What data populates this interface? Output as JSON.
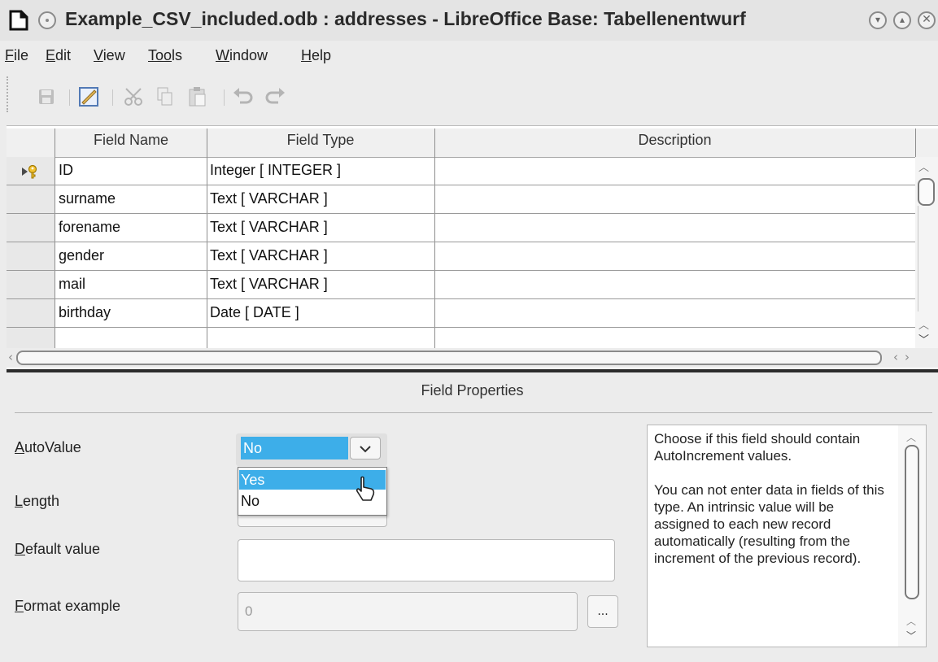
{
  "window": {
    "title": "Example_CSV_included.odb : addresses - LibreOffice Base: Tabellenentwurf",
    "controls": [
      "minimize-icon",
      "maximize-icon",
      "close-icon"
    ]
  },
  "menu": [
    {
      "label": "File",
      "u": "F",
      "rest": "ile"
    },
    {
      "label": "Edit",
      "u": "E",
      "rest": "dit"
    },
    {
      "label": "View",
      "u": "V",
      "rest": "iew"
    },
    {
      "label": "Tools",
      "u": "Too",
      "rest": "ls"
    },
    {
      "label": "Window",
      "u": "W",
      "rest": "indow"
    },
    {
      "label": "Help",
      "u": "H",
      "rest": "elp"
    }
  ],
  "toolbar": [
    "save-icon",
    "edit-mode-icon",
    "cut-icon",
    "copy-icon",
    "paste-icon",
    "undo-icon",
    "redo-icon"
  ],
  "table": {
    "columns": [
      "Field Name",
      "Field Type",
      "Description"
    ],
    "rows": [
      {
        "name": "ID",
        "type": "Integer [ INTEGER ]",
        "description": "",
        "primary_key": true
      },
      {
        "name": "surname",
        "type": "Text [ VARCHAR ]",
        "description": ""
      },
      {
        "name": "forename",
        "type": "Text [ VARCHAR ]",
        "description": ""
      },
      {
        "name": "gender",
        "type": "Text [ VARCHAR ]",
        "description": ""
      },
      {
        "name": "mail",
        "type": "Text [ VARCHAR ]",
        "description": ""
      },
      {
        "name": "birthday",
        "type": "Date [ DATE ]",
        "description": ""
      }
    ]
  },
  "field_properties": {
    "title": "Field Properties",
    "autovalue": {
      "label_u": "A",
      "label_rest": "utoValue",
      "value": "No",
      "options": [
        "Yes",
        "No"
      ],
      "highlighted": "Yes"
    },
    "length": {
      "label_u": "L",
      "label_rest": "ength"
    },
    "default_value": {
      "label_u": "D",
      "label_rest": "efault value",
      "value": ""
    },
    "format_example": {
      "label_u": "F",
      "label_rest": "ormat example",
      "value": "0",
      "button": "..."
    },
    "help_text": "Choose if this field should contain AutoIncrement values.\n\nYou can not enter data in fields of this type. An intrinsic value will be assigned to each new record automatically (resulting from the increment of the previous record)."
  },
  "colors": {
    "selection": "#3daee9",
    "window_bg": "#ececec"
  }
}
